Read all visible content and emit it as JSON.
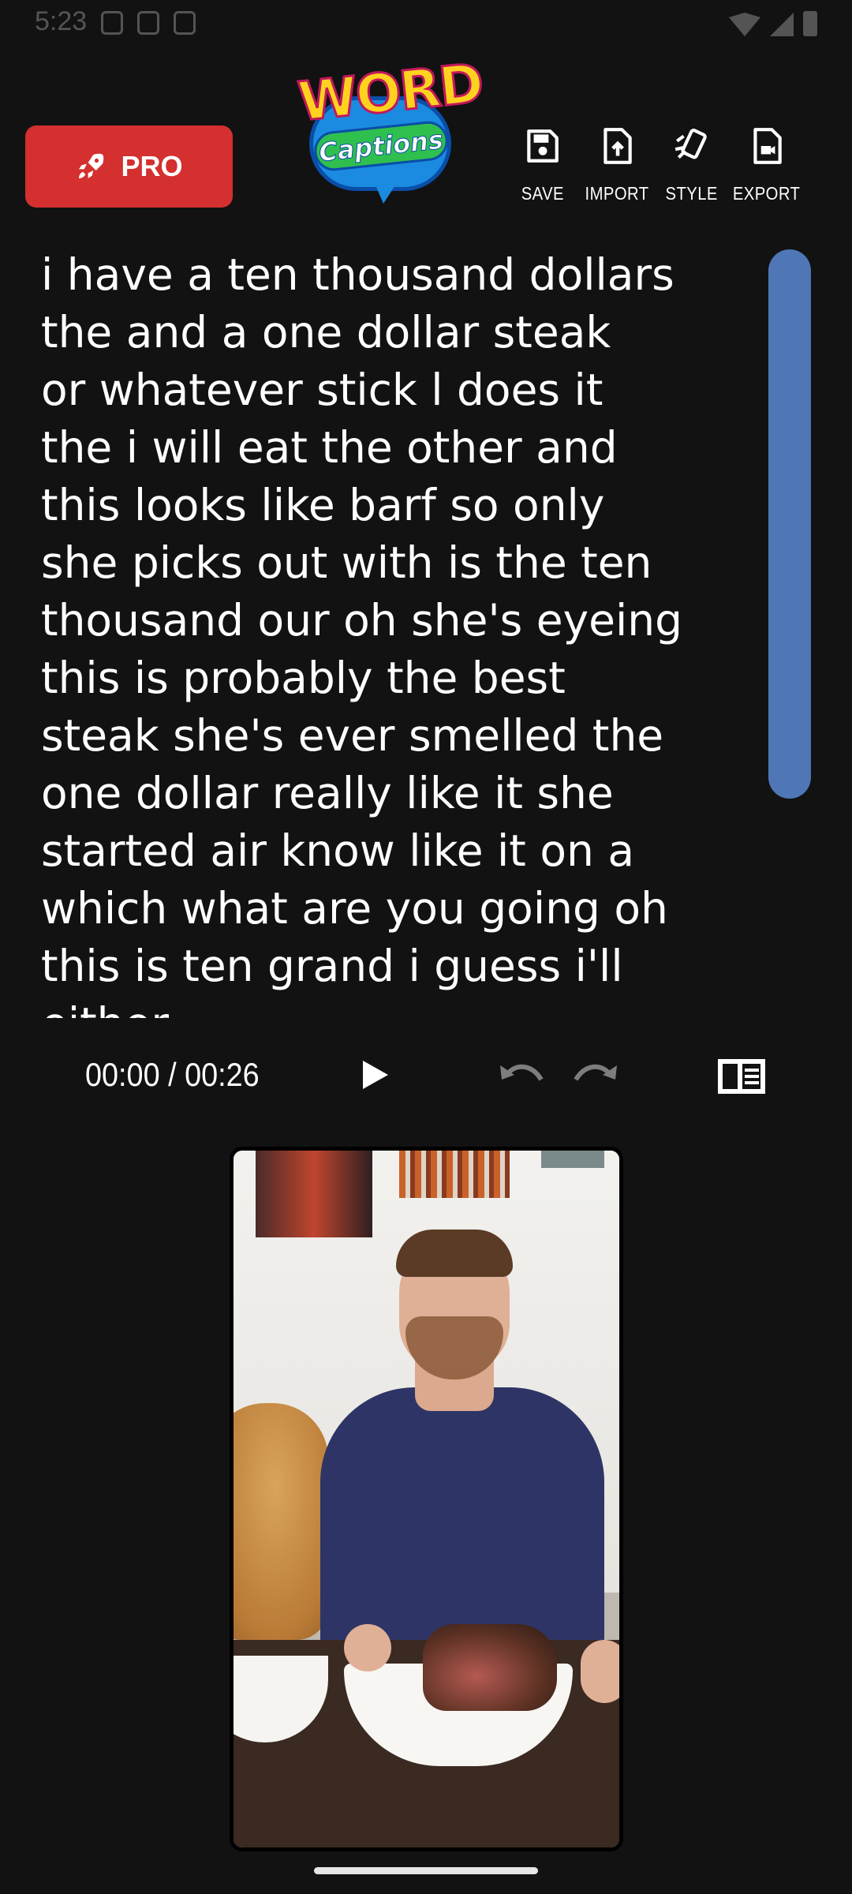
{
  "status_bar": {
    "time": "5:23"
  },
  "header": {
    "pro_label": "PRO",
    "logo_word": "WORD",
    "logo_captions": "Captions",
    "toolbar": [
      {
        "icon": "save-icon",
        "label": "SAVE"
      },
      {
        "icon": "import-icon",
        "label": "IMPORT"
      },
      {
        "icon": "style-icon",
        "label": "STYLE"
      },
      {
        "icon": "export-icon",
        "label": "EXPORT"
      }
    ]
  },
  "transcript": {
    "text": "i have a ten thousand dollars\nthe and a one dollar steak\nor whatever stick l does it\nthe i will eat the other and\nthis looks like barf so only\nshe picks out with is the ten\nthousand our oh she's eyeing\nthis is probably the best\nsteak she's ever smelled the\none dollar really like it she\nstarted air know like it on a\nwhich what are you going oh\nthis is ten grand i guess i'll\neither"
  },
  "player": {
    "time_display": "00:00 / 00:26"
  },
  "colors": {
    "background": "#121212",
    "pro_button": "#d3302f",
    "scroll_thumb": "#4f76b5"
  }
}
